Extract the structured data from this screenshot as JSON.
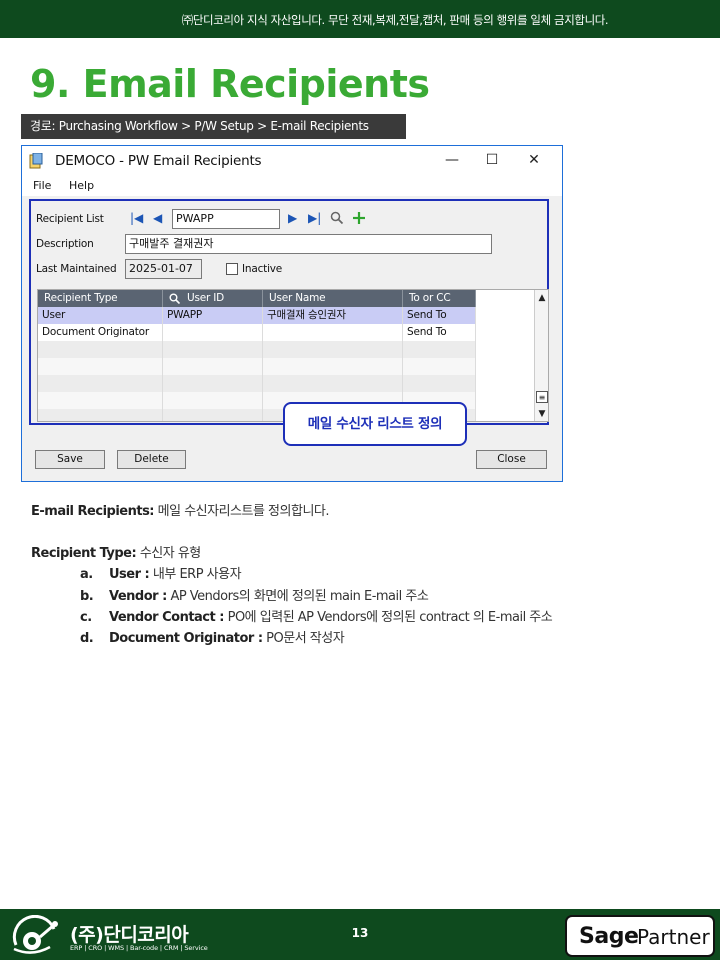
{
  "banner": {
    "notice": "㈜단디코리아 지식 자산입니다. 무단 전재,복제,전달,캡처, 판매 등의 행위를 일체 금지합니다."
  },
  "page": {
    "title": "9. Email Recipients",
    "path": "경로: Purchasing Workflow > P/W Setup > E-mail Recipients"
  },
  "window": {
    "title": "DEMOCO - PW Email Recipients",
    "controls": {
      "minimize": "—",
      "maximize": "☐",
      "close": "✕"
    },
    "menu": [
      "File",
      "Help"
    ],
    "form": {
      "recipient_list_label": "Recipient List",
      "recipient_list_value": "PWAPP",
      "description_label": "Description",
      "description_value": "구매발주 결재권자",
      "last_maintained_label": "Last Maintained",
      "last_maintained_value": "2025-01-07",
      "inactive_label": "Inactive",
      "inactive_checked": false
    },
    "nav_icons": [
      "first-record-icon",
      "previous-record-icon",
      "next-record-icon",
      "last-record-icon",
      "search-icon",
      "add-icon"
    ],
    "grid": {
      "columns": [
        "Recipient Type",
        "User ID",
        "User Name",
        "To or CC"
      ],
      "rows": [
        [
          "User",
          "PWAPP",
          "구매결재 승인권자",
          "Send To"
        ],
        [
          "Document Originator",
          "",
          "",
          "Send To"
        ]
      ]
    },
    "buttons": {
      "save": "Save",
      "delete": "Delete",
      "close": "Close"
    },
    "callout": "메일 수신자 리스트 정의"
  },
  "body": {
    "p1_label": "E-mail Recipients:",
    "p1_text": "메일 수신자리스트를 정의합니다.",
    "p2_label": "Recipient Type:",
    "p2_text": "수신자 유형",
    "items": [
      {
        "marker": "a.",
        "label": "User :",
        "text": "내부 ERP 사용자"
      },
      {
        "marker": "b.",
        "label": "Vendor :",
        "text": "AP Vendors의 화면에 정의된 main E-mail 주소"
      },
      {
        "marker": "c.",
        "label": "Vendor Contact :",
        "text": "PO에 입력된 AP Vendors에 정의된 contract 의 E-mail 주소"
      },
      {
        "marker": "d.",
        "label": "Document Originator :",
        "text": "PO문서 작성자"
      }
    ]
  },
  "footer": {
    "company": "(주)단디코리아",
    "tagline": "ERP | CRO | WMS | Bar-code | CRM | Service",
    "page_number": "13",
    "sage": "Sage",
    "partner": "Partner"
  },
  "colors": {
    "brand_green": "#0e4a1e",
    "title_green": "#3aaa35",
    "highlight_blue": "#1d2fb8",
    "selected_row": "#c9ccf5"
  }
}
